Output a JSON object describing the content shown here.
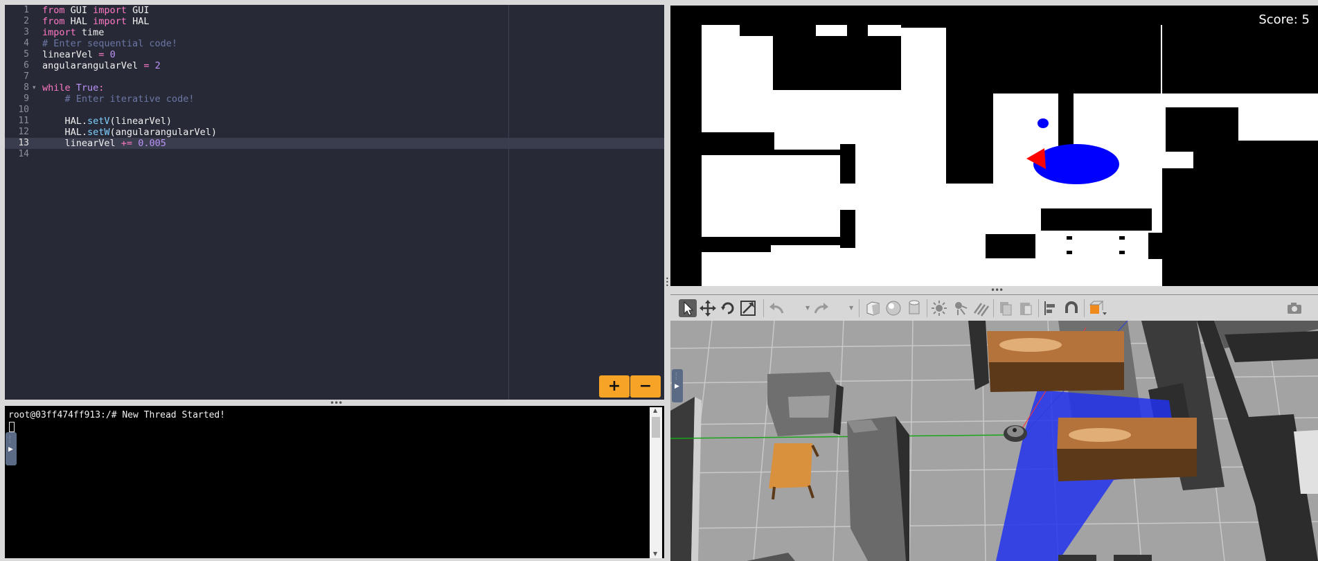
{
  "editor": {
    "line_numbers": [
      "1",
      "2",
      "3",
      "4",
      "5",
      "6",
      "7",
      "8",
      "9",
      "10",
      "11",
      "12",
      "13",
      "14"
    ],
    "lines": {
      "l1": {
        "t1": "from",
        "t2": " GUI ",
        "t3": "import",
        "t4": " GUI"
      },
      "l2": {
        "t1": "from",
        "t2": " HAL ",
        "t3": "import",
        "t4": " HAL"
      },
      "l3": {
        "t1": "import",
        "t2": " time"
      },
      "l4": {
        "t1": "# Enter sequential code!"
      },
      "l5": {
        "t1": "linearVel ",
        "t2": "=",
        "t3": " ",
        "t4": "0"
      },
      "l6": {
        "t1": "angularangularVel ",
        "t2": "=",
        "t3": " ",
        "t4": "2"
      },
      "l8": {
        "t1": "while",
        "t2": " ",
        "t3": "True",
        "t4": ":"
      },
      "l9": {
        "t1": "    # Enter iterative code!"
      },
      "l11": {
        "t1": "    HAL.",
        "t2": "setV",
        "t3": "(linearVel)"
      },
      "l12": {
        "t1": "    HAL.",
        "t2": "setW",
        "t3": "(angularangularVel)"
      },
      "l13": {
        "t1": "    linearVel ",
        "t2": "+=",
        "t3": " ",
        "t4": "0.005"
      }
    },
    "zoom_in": "+",
    "zoom_out": "−"
  },
  "terminal": {
    "output": "root@03ff474ff913:/# New Thread Started!"
  },
  "map": {
    "score": "Score:  5"
  },
  "gazebo": {
    "toolbar_icons": [
      "select-arrow-icon",
      "translate-icon",
      "rotate-icon",
      "scale-icon",
      "undo-icon",
      "redo-icon",
      "box-icon",
      "sphere-icon",
      "cylinder-icon",
      "point-light-icon",
      "spot-light-icon",
      "directional-light-icon",
      "copy-icon",
      "paste-icon",
      "align-icon",
      "snap-icon",
      "view-angle-icon",
      "screenshot-icon"
    ]
  },
  "colors": {
    "editor_bg": "#272a36",
    "accent_orange": "#f7a326",
    "robot_blue": "#0000ff",
    "robot_red": "#ff0000"
  }
}
